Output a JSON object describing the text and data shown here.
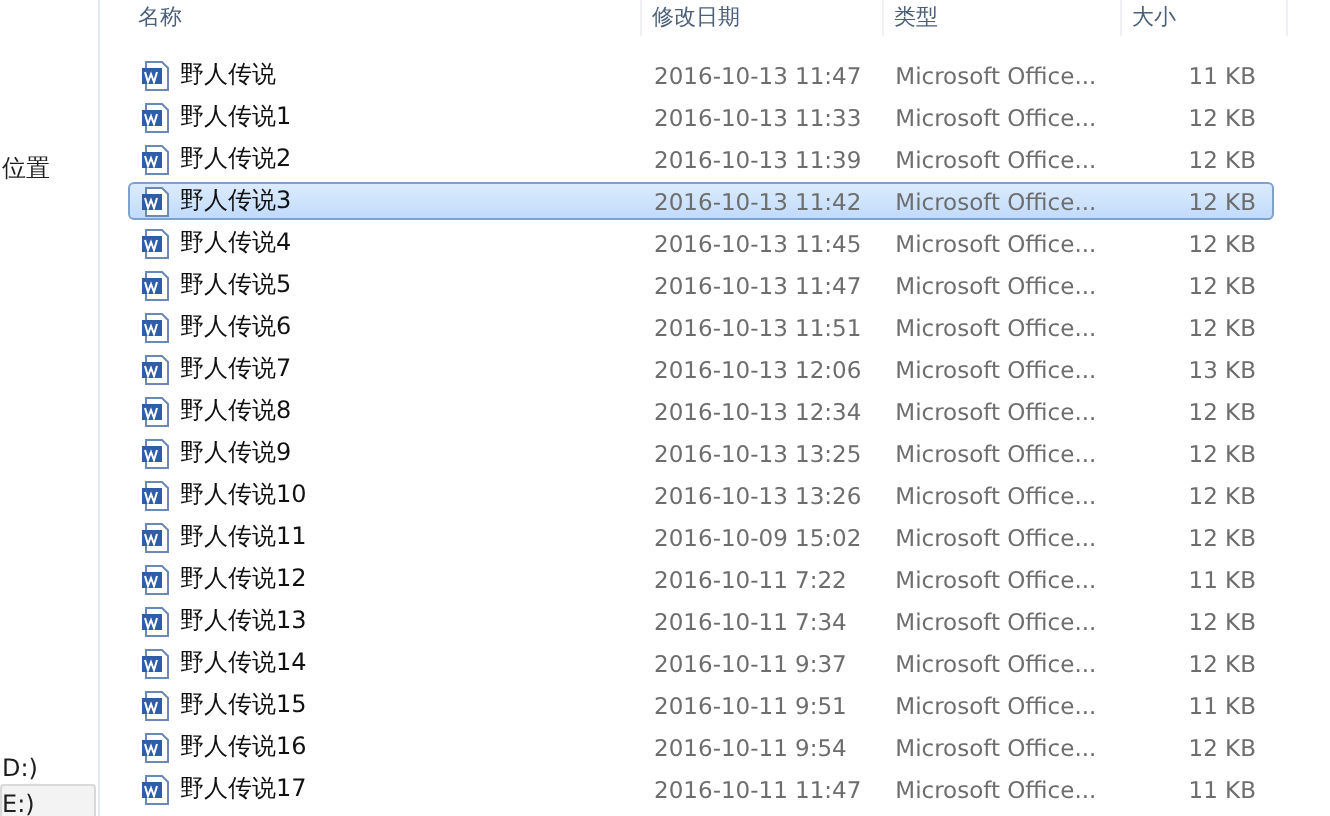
{
  "sidebar": {
    "items": [
      {
        "label": "位置",
        "selected": false
      },
      {
        "label": "D:)",
        "selected": false
      },
      {
        "label": "E:)",
        "selected": true
      }
    ]
  },
  "table": {
    "columns": [
      "名称",
      "修改日期",
      "类型",
      "大小"
    ],
    "rows": [
      {
        "name": "野人传说",
        "date": "2016-10-13 11:47",
        "type": "Microsoft Office...",
        "size": "11 KB",
        "selected": false
      },
      {
        "name": "野人传说1",
        "date": "2016-10-13 11:33",
        "type": "Microsoft Office...",
        "size": "12 KB",
        "selected": false
      },
      {
        "name": "野人传说2",
        "date": "2016-10-13 11:39",
        "type": "Microsoft Office...",
        "size": "12 KB",
        "selected": false
      },
      {
        "name": "野人传说3",
        "date": "2016-10-13 11:42",
        "type": "Microsoft Office...",
        "size": "12 KB",
        "selected": true
      },
      {
        "name": "野人传说4",
        "date": "2016-10-13 11:45",
        "type": "Microsoft Office...",
        "size": "12 KB",
        "selected": false
      },
      {
        "name": "野人传说5",
        "date": "2016-10-13 11:47",
        "type": "Microsoft Office...",
        "size": "12 KB",
        "selected": false
      },
      {
        "name": "野人传说6",
        "date": "2016-10-13 11:51",
        "type": "Microsoft Office...",
        "size": "12 KB",
        "selected": false
      },
      {
        "name": "野人传说7",
        "date": "2016-10-13 12:06",
        "type": "Microsoft Office...",
        "size": "13 KB",
        "selected": false
      },
      {
        "name": "野人传说8",
        "date": "2016-10-13 12:34",
        "type": "Microsoft Office...",
        "size": "12 KB",
        "selected": false
      },
      {
        "name": "野人传说9",
        "date": "2016-10-13 13:25",
        "type": "Microsoft Office...",
        "size": "12 KB",
        "selected": false
      },
      {
        "name": "野人传说10",
        "date": "2016-10-13 13:26",
        "type": "Microsoft Office...",
        "size": "12 KB",
        "selected": false
      },
      {
        "name": "野人传说11",
        "date": "2016-10-09 15:02",
        "type": "Microsoft Office...",
        "size": "12 KB",
        "selected": false
      },
      {
        "name": "野人传说12",
        "date": "2016-10-11 7:22",
        "type": "Microsoft Office...",
        "size": "11 KB",
        "selected": false
      },
      {
        "name": "野人传说13",
        "date": "2016-10-11 7:34",
        "type": "Microsoft Office...",
        "size": "12 KB",
        "selected": false
      },
      {
        "name": "野人传说14",
        "date": "2016-10-11 9:37",
        "type": "Microsoft Office...",
        "size": "12 KB",
        "selected": false
      },
      {
        "name": "野人传说15",
        "date": "2016-10-11 9:51",
        "type": "Microsoft Office...",
        "size": "11 KB",
        "selected": false
      },
      {
        "name": "野人传说16",
        "date": "2016-10-11 9:54",
        "type": "Microsoft Office...",
        "size": "12 KB",
        "selected": false
      },
      {
        "name": "野人传说17",
        "date": "2016-10-11 11:47",
        "type": "Microsoft Office...",
        "size": "11 KB",
        "selected": false
      }
    ]
  }
}
